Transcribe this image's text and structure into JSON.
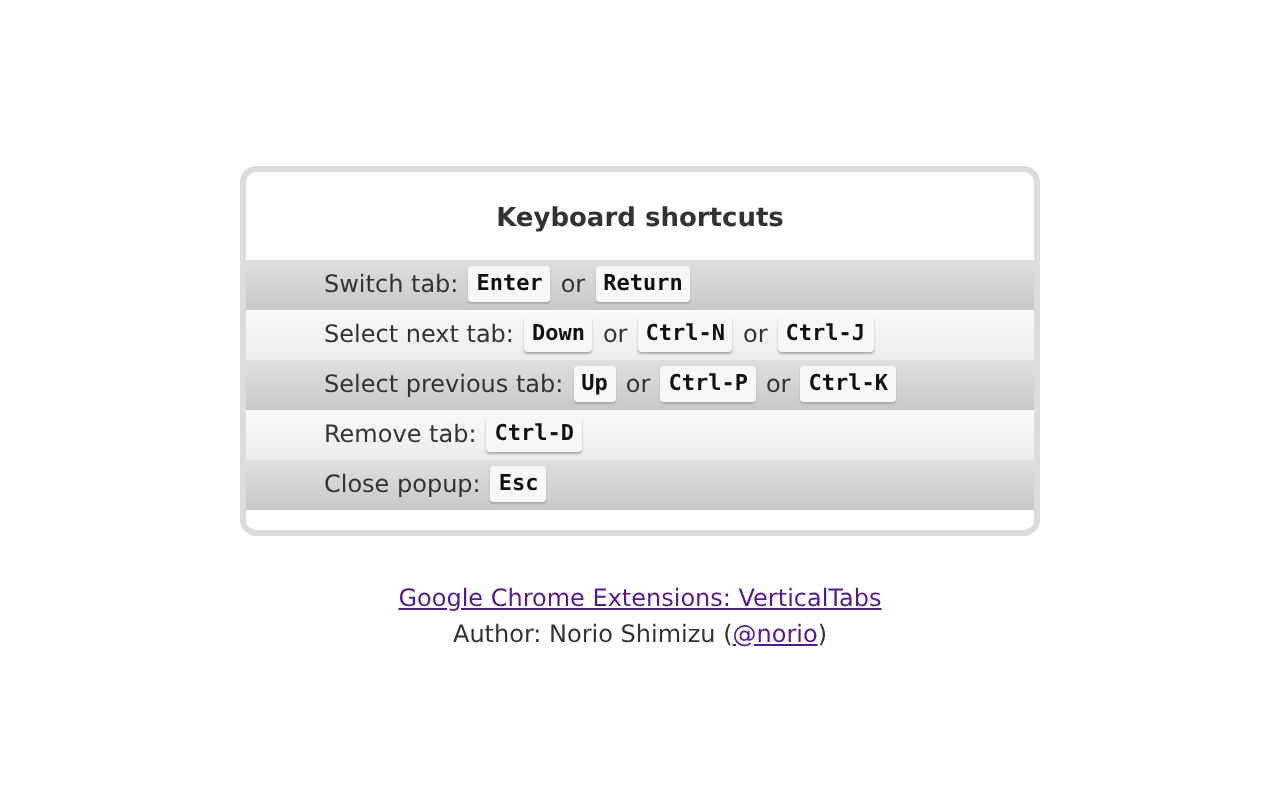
{
  "panel": {
    "title": "Keyboard shortcuts",
    "rows": [
      {
        "label": "Switch tab:",
        "parts": [
          {
            "kind": "key",
            "text": "Enter"
          },
          {
            "kind": "word",
            "text": "or"
          },
          {
            "kind": "key",
            "text": "Return"
          }
        ]
      },
      {
        "label": "Select next tab:",
        "parts": [
          {
            "kind": "key",
            "text": "Down"
          },
          {
            "kind": "word",
            "text": "or"
          },
          {
            "kind": "key",
            "text": "Ctrl-N"
          },
          {
            "kind": "word",
            "text": "or"
          },
          {
            "kind": "key",
            "text": "Ctrl-J"
          }
        ]
      },
      {
        "label": "Select previous tab:",
        "parts": [
          {
            "kind": "key",
            "text": "Up"
          },
          {
            "kind": "word",
            "text": "or"
          },
          {
            "kind": "key",
            "text": "Ctrl-P"
          },
          {
            "kind": "word",
            "text": "or"
          },
          {
            "kind": "key",
            "text": "Ctrl-K"
          }
        ]
      },
      {
        "label": "Remove tab:",
        "parts": [
          {
            "kind": "key",
            "text": "Ctrl-D"
          }
        ]
      },
      {
        "label": "Close popup:",
        "parts": [
          {
            "kind": "key",
            "text": "Esc"
          }
        ]
      }
    ]
  },
  "footer": {
    "link": "Google Chrome Extensions: VerticalTabs",
    "author": [
      {
        "kind": "text",
        "text": "Author: Norio Shimizu ("
      },
      {
        "kind": "link",
        "text": "@norio"
      },
      {
        "kind": "text",
        "text": ")"
      }
    ]
  }
}
